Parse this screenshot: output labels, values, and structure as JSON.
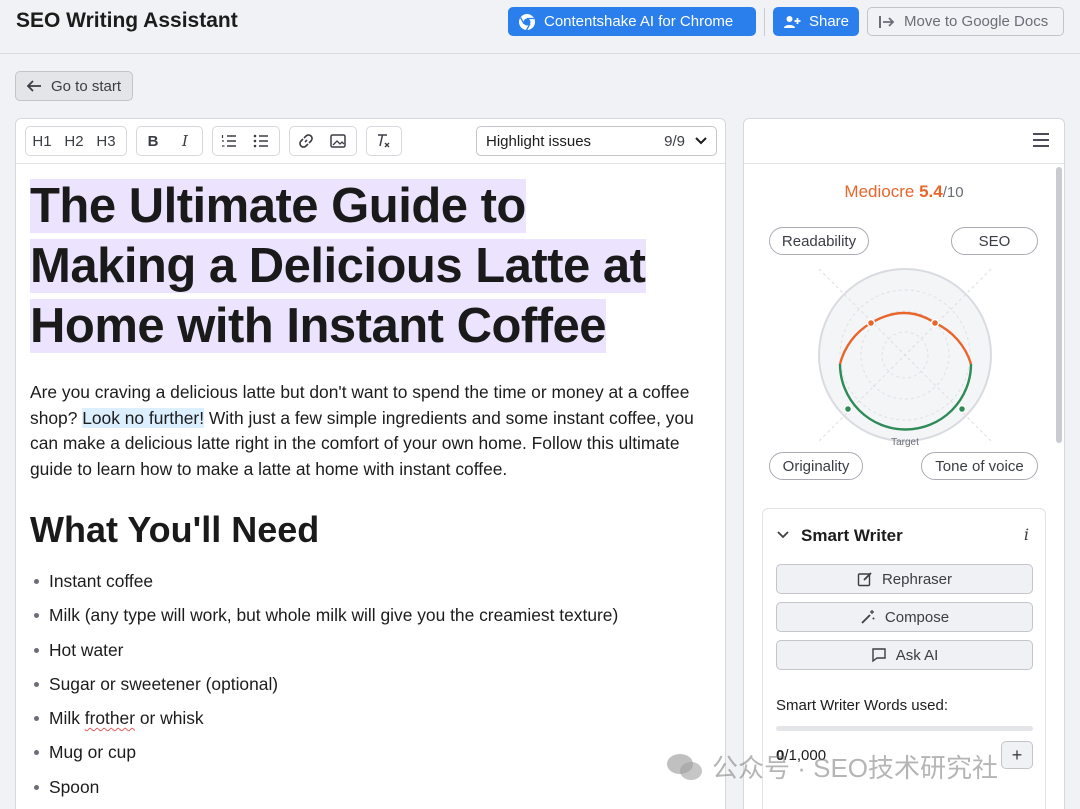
{
  "header": {
    "title": "SEO Writing Assistant",
    "chrome_button": "Contentshake AI for Chrome",
    "share_button": "Share",
    "docs_button": "Move to Google Docs"
  },
  "nav": {
    "go_to_start": "Go to start"
  },
  "toolbar": {
    "h1": "H1",
    "h2": "H2",
    "h3": "H3",
    "bold": "B",
    "italic": "I",
    "highlight_label": "Highlight issues",
    "highlight_count": "9/9"
  },
  "document": {
    "title_line1": "The Ultimate Guide to",
    "title_line2": "Making a Delicious Latte at",
    "title_line3": "Home with Instant Coffee",
    "intro_part1": "Are you craving a delicious latte but don't want to spend the time or money at a coffee shop? ",
    "intro_highlight": "Look no further!",
    "intro_part2": " With just a few simple ingredients and some instant coffee, you can make a delicious latte right in the comfort of your own home. Follow this ultimate guide to learn how to make a latte at home with instant coffee.",
    "section_heading": "What You'll Need",
    "items": [
      "Instant coffee",
      "Milk (any type will work, but whole milk will give you the creamiest texture)",
      "Hot water",
      "Sugar or sweetener (optional)",
      "Mug or cup",
      "Spoon"
    ],
    "item_frother_pre": "Milk ",
    "item_frother_word": "frother",
    "item_frother_post": " or whisk"
  },
  "score_panel": {
    "rating_label": "Mediocre",
    "score": "5.4",
    "score_max": "/10",
    "axes": {
      "readability": "Readability",
      "seo": "SEO",
      "originality": "Originality",
      "tone": "Tone of voice"
    },
    "target_label": "Target",
    "colors": {
      "warning": "#e8652b",
      "good": "#2e8b57"
    }
  },
  "smart_writer": {
    "title": "Smart Writer",
    "info": "i",
    "rephraser": "Rephraser",
    "compose": "Compose",
    "ask_ai": "Ask AI",
    "words_used_label": "Smart Writer Words used:",
    "words_used": "0",
    "words_limit": "/1,000",
    "words_fraction": 0
  },
  "watermark": {
    "text": "公众号 · SEO技术研究社"
  }
}
